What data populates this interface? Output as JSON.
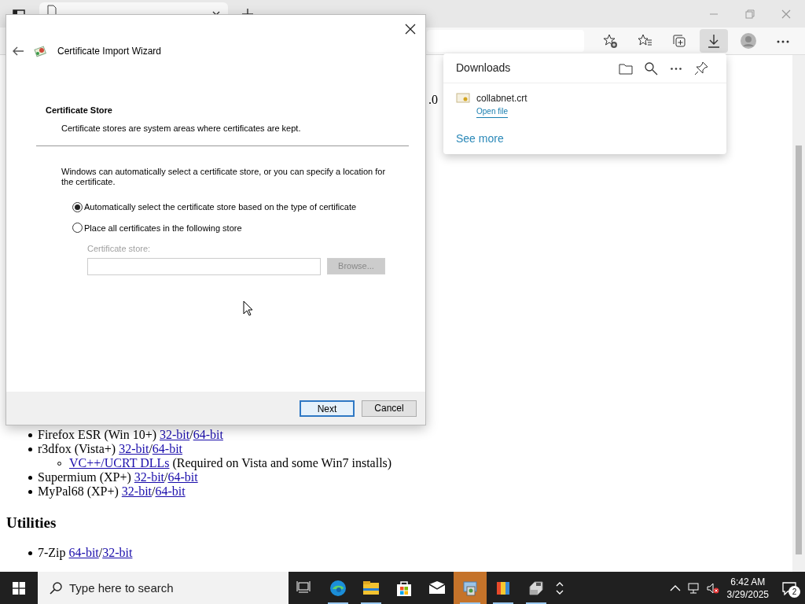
{
  "browser": {
    "download_active": true
  },
  "page": {
    "fragment": ".0",
    "items": [
      {
        "label": "Firefox ESR (Win 10+)",
        "links": [
          "32-bit",
          "64-bit"
        ],
        "separator": "/"
      },
      {
        "label": "r3dfox (Vista+)",
        "links": [
          "32-bit",
          "64-bit"
        ],
        "separator": "/",
        "children": [
          {
            "link": "VC++/UCRT DLLs",
            "label": "(Required on Vista and some Win7 installs)"
          }
        ]
      },
      {
        "label": "Supermium (XP+)",
        "links": [
          "32-bit",
          "64-bit"
        ],
        "separator": "/"
      },
      {
        "label": "MyPal68 (XP+)",
        "links": [
          "32-bit",
          "64-bit"
        ],
        "separator": "/"
      }
    ],
    "sections": [
      {
        "heading": "Utilities",
        "items": [
          {
            "label": "7-Zip",
            "links": [
              "64-bit",
              "32-bit"
            ],
            "separator": "/"
          }
        ]
      }
    ]
  },
  "downloads": {
    "title": "Downloads",
    "files": [
      {
        "name": "collabnet.crt",
        "action": "Open file"
      }
    ],
    "see_more": "See more"
  },
  "dialog": {
    "title": "Certificate Import Wizard",
    "heading": "Certificate Store",
    "subheading": "Certificate stores are system areas where certificates are kept.",
    "intro": "Windows can automatically select a certificate store, or you can specify a location for the certificate.",
    "options": [
      {
        "label": "Automatically select the certificate store based on the type of certificate",
        "selected": true
      },
      {
        "label": "Place all certificates in the following store",
        "selected": false
      }
    ],
    "store_field": {
      "label": "Certificate store:",
      "disabled": true
    },
    "browse": {
      "label": "Browse...",
      "disabled": true
    },
    "buttons": [
      {
        "label": "Next",
        "default": true
      },
      {
        "label": "Cancel",
        "default": false
      }
    ]
  },
  "taskbar": {
    "search": {
      "placeholder": "Type here to search"
    },
    "apps": [
      {
        "kind": "taskview",
        "running": false,
        "selected": false
      },
      {
        "kind": "edge",
        "running": true,
        "selected": false
      },
      {
        "kind": "explorer",
        "running": true,
        "selected": false
      },
      {
        "kind": "store",
        "running": false,
        "selected": false
      },
      {
        "kind": "mail",
        "running": false,
        "selected": false
      },
      {
        "kind": "installer",
        "running": true,
        "selected": true
      },
      {
        "kind": "paint",
        "running": true,
        "selected": false
      },
      {
        "kind": "drive",
        "running": true,
        "selected": false
      }
    ],
    "time": "6:42 AM",
    "date": "3/29/2025",
    "notifications": "2"
  }
}
